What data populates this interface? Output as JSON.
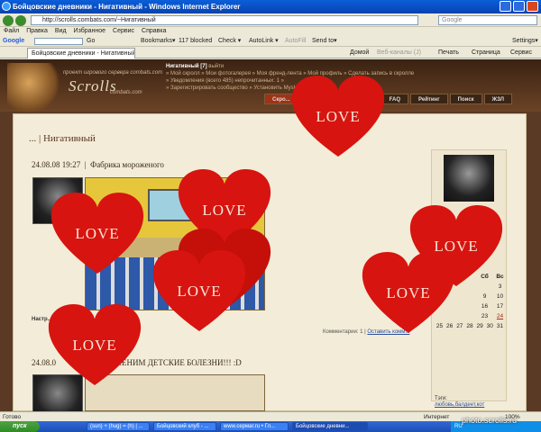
{
  "window": {
    "title": "Бойцовские дневники - Нигативный - Windows Internet Explorer",
    "min": "",
    "max": "",
    "close": ""
  },
  "address": {
    "url": "http://scrolls.combats.com/~Нигативный",
    "search_placeholder": "Google"
  },
  "menu": [
    "Файл",
    "Правка",
    "Вид",
    "Избранное",
    "Сервис",
    "Справка"
  ],
  "googlebar": {
    "logo": "Google",
    "go": "Go",
    "bookmarks": "Bookmarks▾",
    "blocked": "117 blocked",
    "check": "Check ▾",
    "autolink": "AutoLink ▾",
    "autofill": "AutoFill",
    "sendto": "Send to▾",
    "settings": "Settings▾"
  },
  "tabbar": {
    "tab": "Бойцовские дневники - Нигативный",
    "home": "Домой",
    "rss": "Веб-каналы (J)",
    "print": "Печать",
    "page": "Страница",
    "tools": "Сервис"
  },
  "header": {
    "logo": "Scrolls",
    "logo_sub": "проект игрового сервера combats.com",
    "logo_sub2": "combats.com",
    "user": "Нигативный [7]",
    "logout": "выйти",
    "links": [
      "» Мой скролл » Мои фотогалерея » Моя френд-лента » Мой профиль » Сделать запись в скролле",
      "» Уведомления (всего 485) непрочитанных: 1 »",
      "» Зарегистрировать сообщество » Установить Myskin"
    ],
    "tabs": [
      "Скро...",
      "FAQ",
      "Рейтинг",
      "Поиск",
      "ЖЗЛ"
    ]
  },
  "blog": {
    "title": "... | Нигативный"
  },
  "posts": [
    {
      "date": "24.08.08 19:27",
      "subject": "Фабрика мороженого",
      "settings": "Настр...",
      "comments_label": "Комментарии: 1 |",
      "leave_comment": "Оставить комм..."
    },
    {
      "date": "24.08.0",
      "subject": "...ЕНИМ ДЕТСКИЕ БОЛЕЗНИ!!! :D"
    }
  ],
  "calendar": {
    "days": [
      "Сб",
      "Вс"
    ],
    "rows": [
      [
        "",
        "3"
      ],
      [
        "9",
        "10"
      ],
      [
        "16",
        "17"
      ],
      [
        "23",
        "24"
      ],
      [
        "25",
        "26",
        "27",
        "28",
        "29",
        "30",
        "31"
      ]
    ],
    "today": "24"
  },
  "tags": {
    "label": "Тэги:",
    "items": "любовь,балдеет,кот"
  },
  "hearts": {
    "label": "LOVE",
    "color": "#d7140f"
  },
  "status": {
    "left": "Готово",
    "zone": "Интернет",
    "zoom": "100%"
  },
  "taskbar": {
    "start": "пуск",
    "tasks": [
      "(sun) + (hug) = (h) | ...",
      "Бойцовский клуб - ...",
      "www.cepмar.ru • Гл...",
      "Бойцовские дневни..."
    ],
    "lang": "RU",
    "clock": ""
  },
  "watermark": "photo.scrolls.ru"
}
